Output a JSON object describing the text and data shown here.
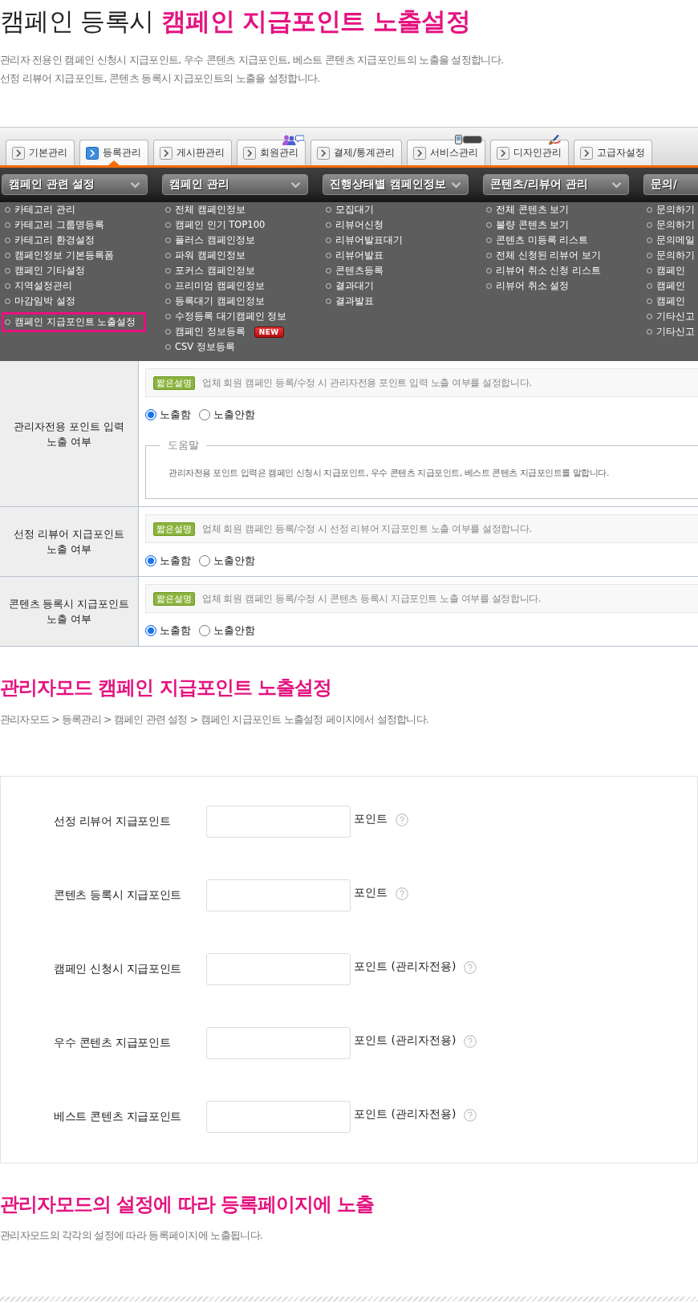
{
  "header": {
    "title": "캠페인 등록시 **캠페인 지급포인트 노출설정**",
    "description": [
      "관리자 전용인 캠페인 신청시 지급포인트, 우수 콘텐츠 지급포인트, 베스트 콘텐츠 지급포인트의 노출을 설정합니다.",
      "선정 리뷰어 지급포인트, 콘텐츠 등록시 지급포인트의 노출을 설정합니다."
    ]
  },
  "admin_screenshot": {
    "tabs": [
      {
        "label": "기본관리",
        "selected": false
      },
      {
        "label": "등록관리",
        "selected": true
      },
      {
        "label": "게시판관리",
        "selected": false
      },
      {
        "label": "회원관리",
        "selected": false
      },
      {
        "label": "결제/통계관리",
        "selected": false
      },
      {
        "label": "서비스관리",
        "selected": false
      },
      {
        "label": "디자인관리",
        "selected": false
      },
      {
        "label": "고급자설정",
        "selected": false
      }
    ],
    "menu_columns": [
      {
        "title": "캠페인 관련 설정",
        "cut_off": false,
        "items": [
          {
            "label": "카테고리 관리",
            "highlighted": false
          },
          {
            "label": "카테고리 그룹명등록",
            "highlighted": false
          },
          {
            "label": "카테고리 환경설정",
            "highlighted": false
          },
          {
            "label": "캠페인정보 기본등록폼",
            "highlighted": false
          },
          {
            "label": "캠페인 기타설정",
            "highlighted": false
          },
          {
            "label": "지역설정관리",
            "highlighted": false
          },
          {
            "label": "마감임박 설정",
            "highlighted": false
          },
          {
            "label": "캠페인 지급포인트 노출설정",
            "highlighted": true
          }
        ]
      },
      {
        "title": "캠페인 관리",
        "cut_off": false,
        "items": [
          {
            "label": "전체 캠페인정보",
            "highlighted": false
          },
          {
            "label": "캠페인 인기 TOP100",
            "highlighted": false
          },
          {
            "label": "플러스 캠페인정보",
            "highlighted": false
          },
          {
            "label": "파워 캠페인정보",
            "highlighted": false
          },
          {
            "label": "포커스 캠페인정보",
            "highlighted": false
          },
          {
            "label": "프리미엄 캠페인정보",
            "highlighted": false
          },
          {
            "label": "등록대기 캠페인정보",
            "highlighted": false
          },
          {
            "label": "수정등록 대기캠페인 정보",
            "highlighted": false
          },
          {
            "label": "캠페인 정보등록",
            "highlighted": false,
            "badge": "NEW"
          },
          {
            "label": "CSV 정보등록",
            "highlighted": false
          }
        ]
      },
      {
        "title": "진행상태별 캠페인정보",
        "cut_off": false,
        "items": [
          {
            "label": "모집대기",
            "highlighted": false
          },
          {
            "label": "리뷰어신청",
            "highlighted": false
          },
          {
            "label": "리뷰어발표대기",
            "highlighted": false
          },
          {
            "label": "리뷰어발표",
            "highlighted": false
          },
          {
            "label": "콘텐츠등록",
            "highlighted": false
          },
          {
            "label": "결과대기",
            "highlighted": false
          },
          {
            "label": "결과발표",
            "highlighted": false
          }
        ]
      },
      {
        "title": "콘텐츠/리뷰어 관리",
        "cut_off": false,
        "items": [
          {
            "label": "전체 콘텐츠 보기",
            "highlighted": false
          },
          {
            "label": "불량 콘텐츠 보기",
            "highlighted": false
          },
          {
            "label": "콘텐츠 미등록 리스트",
            "highlighted": false
          },
          {
            "label": "전체 신청된 리뷰어 보기",
            "highlighted": false
          },
          {
            "label": "리뷰어 취소 신청 리스트",
            "highlighted": false
          },
          {
            "label": "리뷰어 취소 설정",
            "highlighted": false
          }
        ]
      },
      {
        "title": "문의/",
        "cut_off": true,
        "items": [
          {
            "label": "문의하기",
            "highlighted": false
          },
          {
            "label": "문의하기",
            "highlighted": false
          },
          {
            "label": "문의메일",
            "highlighted": false
          },
          {
            "label": "문의하기",
            "highlighted": false
          },
          {
            "label": "캠페인",
            "highlighted": false
          },
          {
            "label": "캠페인",
            "highlighted": false
          },
          {
            "label": "캠페인",
            "highlighted": false
          },
          {
            "label": "기타신고",
            "highlighted": false
          },
          {
            "label": "기타신고",
            "highlighted": false
          }
        ]
      }
    ],
    "settings": [
      {
        "label": "관리자전용 포인트 입력\n노출 여부",
        "badge": "짧은설명",
        "description": "업체 회원 캠페인 등록/수정 시 관리자전용 포인트 입력 노출 여부를 설정합니다.",
        "options": [
          {
            "label": "노출함",
            "selected": true
          },
          {
            "label": "노출안함",
            "selected": false
          }
        ],
        "help": {
          "title": "도움말",
          "text": "관리자전용 포인트 입력은 캠페인 신청시 지급포인트, 우수 콘텐츠 지급포인트, 베스트 콘텐츠 지급포인트를 말합니다."
        }
      },
      {
        "label": "선정 리뷰어 지급포인트\n노출 여부",
        "badge": "짧은설명",
        "description": "업체 회원 캠페인 등록/수정 시 선정 리뷰어 지급포인트 노출 여부를 설정합니다.",
        "options": [
          {
            "label": "노출함",
            "selected": true
          },
          {
            "label": "노출안함",
            "selected": false
          }
        ]
      },
      {
        "label": "콘텐츠 등록시 지급포인트\n노출 여부",
        "badge": "짧은설명",
        "description": "업체 회원 캠페인 등록/수정 시 콘텐츠 등록시 지급포인트 노출 여부를 설정합니다.",
        "options": [
          {
            "label": "노출함",
            "selected": true
          },
          {
            "label": "노출안함",
            "selected": false
          }
        ]
      }
    ]
  },
  "admin_mode": {
    "title": "관리자모드 캠페인 지급포인트 노출설정",
    "path": "관리자모드 > 등록관리 > 캠페인 관련 설정 > 캠페인 지급포인트 노출설정 페이지에서 설정합니다.",
    "fields": [
      {
        "label": "선정 리뷰어 지급포인트",
        "unit": "포인트"
      },
      {
        "label": "콘텐츠 등록시 지급포인트",
        "unit": "포인트"
      },
      {
        "label": "캠페인 신청시 지급포인트",
        "unit": "포인트 (관리자전용)"
      },
      {
        "label": "우수 콘텐츠 지급포인트",
        "unit": "포인트 (관리자전용)"
      },
      {
        "label": "베스트 콘텐츠 지급포인트",
        "unit": "포인트 (관리자전용)"
      }
    ]
  },
  "register_exposure": {
    "title": "관리자모드의 설정에 따라 등록페이지에 노출",
    "text": "관리자모드의 각각의 설정에 따라 등록페이지에 노출됩니다."
  }
}
